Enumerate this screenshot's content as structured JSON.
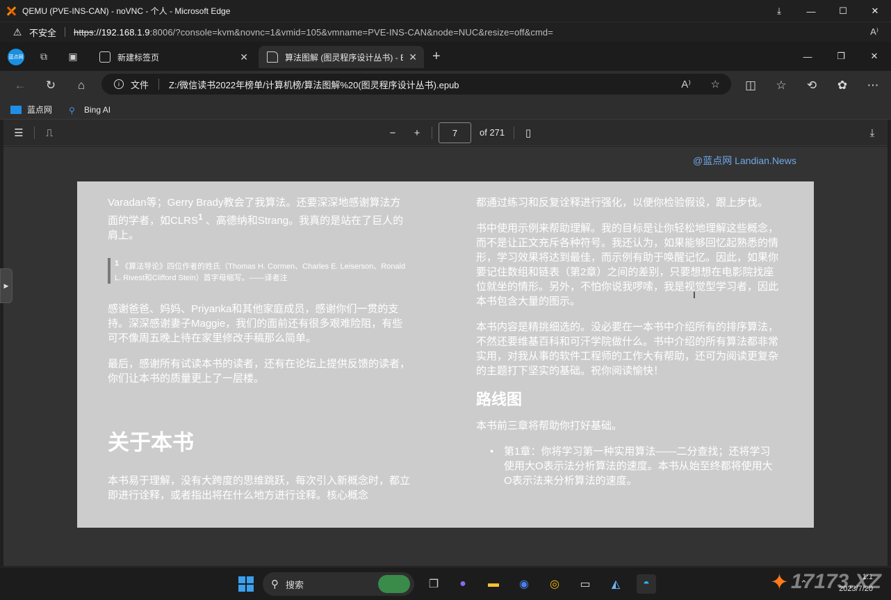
{
  "outer_window": {
    "title": "QEMU (PVE-INS-CAN) - noVNC - 个人 - Microsoft Edge",
    "insecure_label": "不安全",
    "url_scheme": "https",
    "url_host": "://192.168.1.9",
    "url_rest": ":8006/?console=kvm&novnc=1&vmid=105&vmname=PVE-INS-CAN&node=NUC&resize=off&cmd=",
    "readaloud_icon": "A⁾"
  },
  "tabs": [
    {
      "label": "新建标签页",
      "active": false
    },
    {
      "label": "算法图解 (图灵程序设计丛书) - E",
      "active": true
    }
  ],
  "profile_label": "蓝点网",
  "address": {
    "file_label": "文件",
    "path": "Z:/微信读书2022年榜单/计算机榜/算法图解%20(图灵程序设计丛书).epub"
  },
  "favorites": [
    {
      "label": "蓝点网",
      "icon": "landian-icon"
    },
    {
      "label": "Bing AI",
      "icon": "search-icon"
    }
  ],
  "pdf_toolbar": {
    "page_current": "7",
    "page_total": "of 271"
  },
  "watermark": "@蓝点网 Landian.News",
  "page": {
    "left": {
      "p1a": "Varadan等；Gerry Brady教会了我算法。还要深深地感谢算法方面的学者，如CLRS",
      "p1sup": "1",
      "p1b": " 、高德纳和Strang。我真的是站在了巨人的肩上。",
      "footnote_num": "1",
      "footnote": " 《算法导论》四位作者的姓氏（Thomas H. Cormen、Charles E. Leiserson、Ronald L. Rivest和Clifford Stein）首字母缩写。——译者注",
      "p2": "感谢爸爸、妈妈、Priyanka和其他家庭成员，感谢你们一贯的支持。深深感谢妻子Maggie，我们的面前还有很多艰难险阻，有些可不像周五晚上待在家里修改手稿那么简单。",
      "p3": "最后，感谢所有试读本书的读者，还有在论坛上提供反馈的读者，你们让本书的质量更上了一层楼。",
      "heading": "关于本书",
      "p4": "本书易于理解，没有大跨度的思维跳跃，每次引入新概念时，都立即进行诠释，或者指出将在什么地方进行诠释。核心概念"
    },
    "right": {
      "p1": "都通过练习和反复诠释进行强化，以便你检验假设，跟上步伐。",
      "p2": "书中使用示例来帮助理解。我的目标是让你轻松地理解这些概念，而不是让正文充斥各种符号。我还认为，如果能够回忆起熟悉的情形，学习效果将达到最佳，而示例有助于唤醒记忆。因此，如果你要记住数组和链表（第2章）之间的差别，只要想想在电影院找座位就坐的情形。另外，不怕你说我啰嗦，我是视觉型学习者，因此本书包含大量的图示。",
      "p3": "本书内容是精挑细选的。没必要在一本书中介绍所有的排序算法，不然还要维基百科和可汗学院做什么。书中介绍的所有算法都非常实用，对我从事的软件工程师的工作大有帮助，还可为阅读更复杂的主题打下坚实的基础。祝你阅读愉快！",
      "heading": "路线图",
      "p4": "本书前三章将帮助你打好基础。",
      "bullet1": "第1章：你将学习第一种实用算法——二分查找；还将学习使用大O表示法分析算法的速度。本书从始至终都将使用大O表示法来分析算法的速度。"
    }
  },
  "taskbar": {
    "search_label": "搜索",
    "clock_time": "1:1",
    "clock_date": "2023/7/20",
    "watermark": "17173.XZ"
  },
  "colors": {
    "page_bg": "#cccccc",
    "viewer_bg": "#333333",
    "accent": "#1a8fe0"
  }
}
